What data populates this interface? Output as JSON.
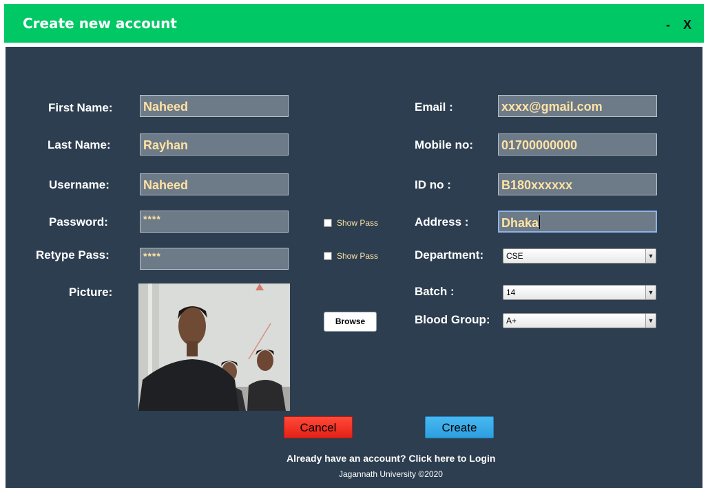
{
  "window": {
    "title": "Create new account",
    "minimize": "-",
    "close": "X"
  },
  "form": {
    "first_name": {
      "label": "First Name:",
      "value": "Naheed"
    },
    "last_name": {
      "label": "Last Name:",
      "value": "Rayhan"
    },
    "username": {
      "label": "Username:",
      "value": "Naheed"
    },
    "password": {
      "label": "Password:",
      "value": "****",
      "show_label": "Show Pass"
    },
    "retype_pass": {
      "label": "Retype Pass:",
      "value": "****",
      "show_label": "Show Pass"
    },
    "picture": {
      "label": "Picture:"
    },
    "email": {
      "label": "Email :",
      "value": "xxxx@gmail.com"
    },
    "mobile": {
      "label": "Mobile no:",
      "value": "01700000000"
    },
    "id_no": {
      "label": "ID no :",
      "value": "B180xxxxxx"
    },
    "address": {
      "label": "Address :",
      "value": "Dhaka"
    },
    "department": {
      "label": "Department:",
      "value": "CSE"
    },
    "batch": {
      "label": "Batch :",
      "value": "14"
    },
    "blood_group": {
      "label": "Blood Group:",
      "value": "A+"
    }
  },
  "buttons": {
    "browse": "Browse",
    "cancel": "Cancel",
    "create": "Create"
  },
  "login_link": "Already have an account? Click here to Login",
  "footer": "Jagannath University ©2020",
  "colors": {
    "titlebar": "#00c865",
    "panel": "#2c3e50",
    "field_text": "#ffe3a3",
    "cancel": "#f0281e",
    "create": "#36a9ea"
  }
}
